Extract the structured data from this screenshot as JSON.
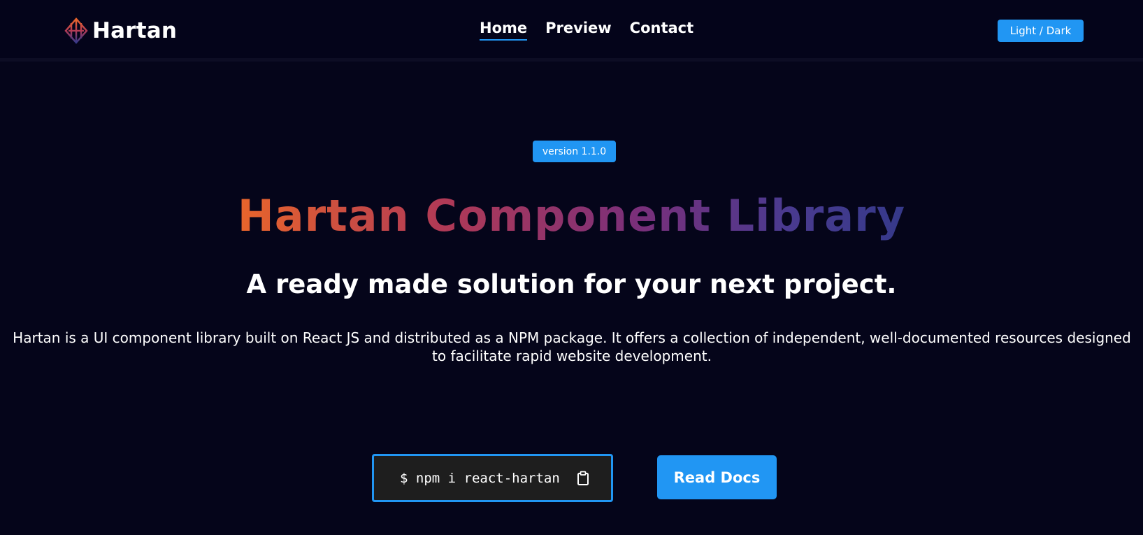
{
  "header": {
    "brand_name": "Hartan",
    "brand_logo_icon": "hartan-logo-icon",
    "nav": [
      {
        "label": "Home",
        "active": true
      },
      {
        "label": "Preview",
        "active": false
      },
      {
        "label": "Contact",
        "active": false
      }
    ],
    "theme_toggle_label": "Light / Dark"
  },
  "hero": {
    "version_badge": "version 1.1.0",
    "title": "Hartan Component Library",
    "subtitle": "A ready made solution for your next project.",
    "description": "Hartan is a UI component library built on React JS and distributed as a NPM package. It offers a collection of independent, well-documented resources designed to facilitate rapid website development.",
    "install_command": "$ npm i react-hartan",
    "copy_icon": "clipboard-icon",
    "read_docs_label": "Read Docs"
  },
  "colors": {
    "background": "#05051a",
    "accent": "#2196f3",
    "title_gradient": [
      "#e8652b",
      "#b23a55",
      "#7a2f7a",
      "#35398a"
    ]
  }
}
